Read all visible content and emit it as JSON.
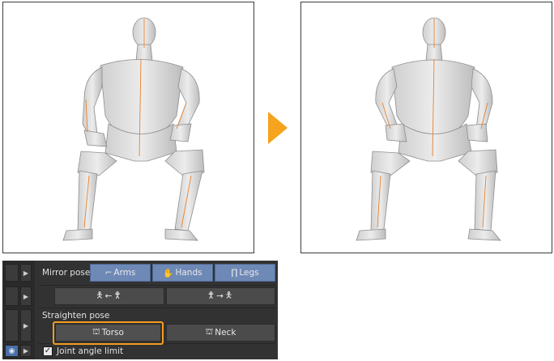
{
  "panel": {
    "mirror_label": "Mirror pose",
    "arms_label": "Arms",
    "hands_label": "Hands",
    "legs_label": "Legs",
    "mirror_left_to_right": "←",
    "mirror_right_to_left": "→",
    "straighten_label": "Straighten pose",
    "torso_label": "Torso",
    "neck_label": "Neck",
    "joint_limit_label": "Joint angle limit",
    "joint_limit_checked": true
  },
  "colors": {
    "accent_highlight": "#f39c1f",
    "arrow": "#f6a31d",
    "active_button": "#6f89b7",
    "panel_bg": "#323232"
  },
  "icons": [
    "arms-icon",
    "hands-icon",
    "legs-icon",
    "figure-icon",
    "torso-icon",
    "neck-icon",
    "eye-icon",
    "checkmark-icon",
    "play-arrow-icon"
  ]
}
